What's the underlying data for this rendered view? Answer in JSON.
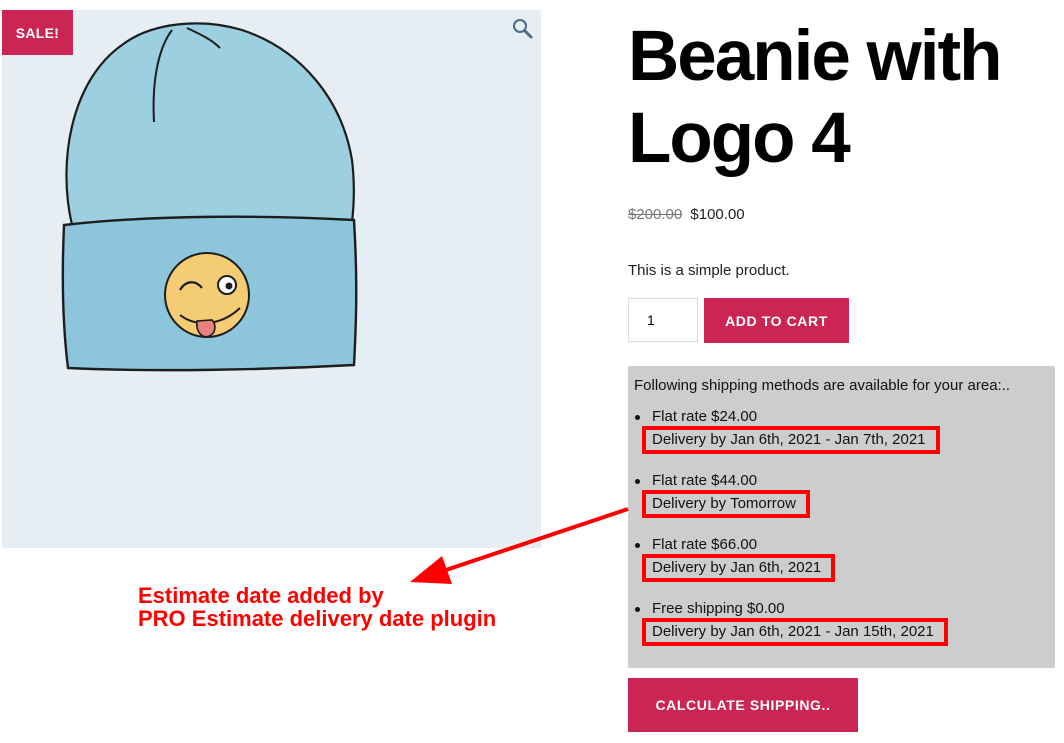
{
  "product": {
    "sale_badge": "SALE!",
    "title_line1": "Beanie with",
    "title_line2": "Logo 4",
    "old_price": "$200.00",
    "price": "$100.00",
    "short_description": "This is a simple product.",
    "quantity": "1",
    "add_to_cart_label": "ADD TO CART",
    "zoom_icon": "magnifier-icon",
    "image": "beanie-illustration"
  },
  "shipping": {
    "intro": "Following shipping methods are available for your area:..",
    "methods": [
      {
        "name": "Flat rate $24.00",
        "delivery": "Delivery by Jan 6th, 2021 - Jan 7th, 2021"
      },
      {
        "name": "Flat rate $44.00",
        "delivery": "Delivery by Tomorrow"
      },
      {
        "name": "Flat rate $66.00",
        "delivery": "Delivery by Jan 6th, 2021"
      },
      {
        "name": "Free shipping $0.00",
        "delivery": "Delivery by Jan 6th, 2021 - Jan 15th, 2021"
      }
    ],
    "calculate_label": "CALCULATE SHIPPING.."
  },
  "annotation": {
    "line1": "Estimate date added by",
    "line2": "PRO Estimate delivery date plugin"
  },
  "colors": {
    "accent": "#cb2553",
    "highlight": "#ff0000",
    "shipping_bg": "#cdcdcd",
    "image_bg": "#e7eef3"
  }
}
